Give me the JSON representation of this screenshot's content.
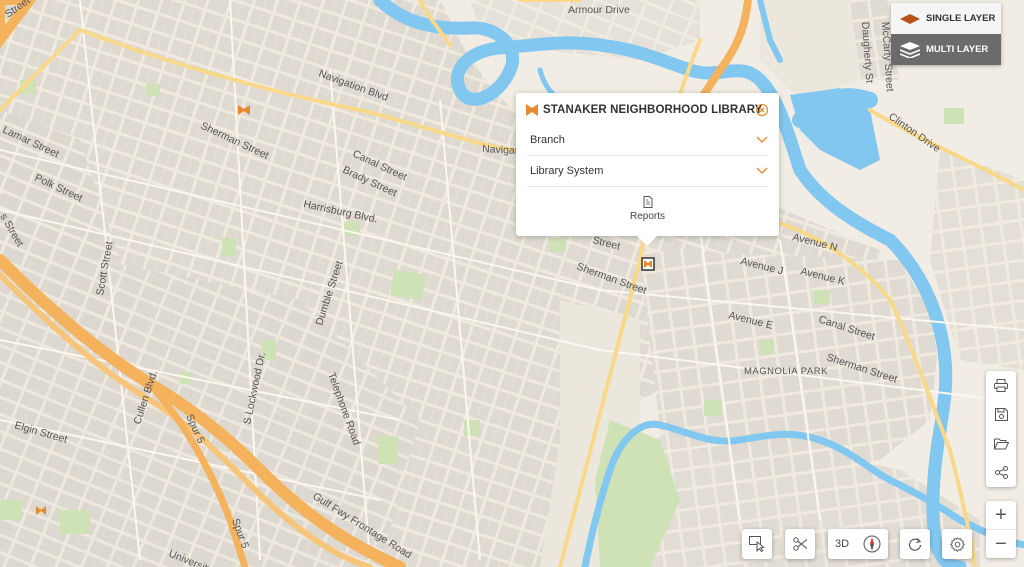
{
  "map": {
    "streets": {
      "navigation": "Navigation Blvd",
      "navigation_short": "Navigat",
      "armour": "Armour Drive",
      "sherman_west": "Sherman Street",
      "canal_west": "Canal Street",
      "brady": "Brady Street",
      "lamar": "Lamar Street",
      "polk": "Polk Street",
      "harrisburg": "Harrisburg Blvd.",
      "scott": "Scott Street",
      "dumble": "Dumble Street",
      "lockwood": "S Lockwood Dr.",
      "telephone": "Telephone Road",
      "cullen": "Cullen Blvd.",
      "spur5a": "Spur 5",
      "spur5b": "Spur 5",
      "elgin": "Elgin Street",
      "gulf_fwy": "Gulf Fwy Frontage Road",
      "university": "University B",
      "clinton": "Clinton Drive",
      "daugherty": "Daugherty St",
      "mccarty": "McCarty Street",
      "avenue_n": "Avenue N",
      "avenue_j": "Avenue J",
      "avenue_k": "Avenue K",
      "avenue_e": "Avenue E",
      "canal_east": "Canal Street",
      "sherman_east": "Sherman Street",
      "sherman_mid": "Sherman Street",
      "street_fragment_top": "Street",
      "street_fragment_left": "s Street",
      "street_fragment_popup": "Street"
    },
    "park_label": "MAGNOLIA PARK",
    "colors": {
      "water": "#82c7f0",
      "highway": "#f4b25c",
      "road": "#f8d98a",
      "marker": "#e8892b",
      "park": "#cfe2b6"
    }
  },
  "popup": {
    "title": "STANAKER NEIGHBORHOOD LIBRARY",
    "icon": "library-marker-icon",
    "rows": [
      {
        "label": "Branch"
      },
      {
        "label": "Library System"
      }
    ],
    "reports_label": "Reports"
  },
  "layers": {
    "single_label": "SINGLE LAYER",
    "multi_label": "MULTI LAYER"
  },
  "tools": {
    "side": [
      "print-icon",
      "save-icon",
      "folder-icon",
      "share-icon"
    ],
    "zoom_in": "+",
    "zoom_out": "−",
    "bottom": {
      "label_3d": "3D"
    }
  }
}
